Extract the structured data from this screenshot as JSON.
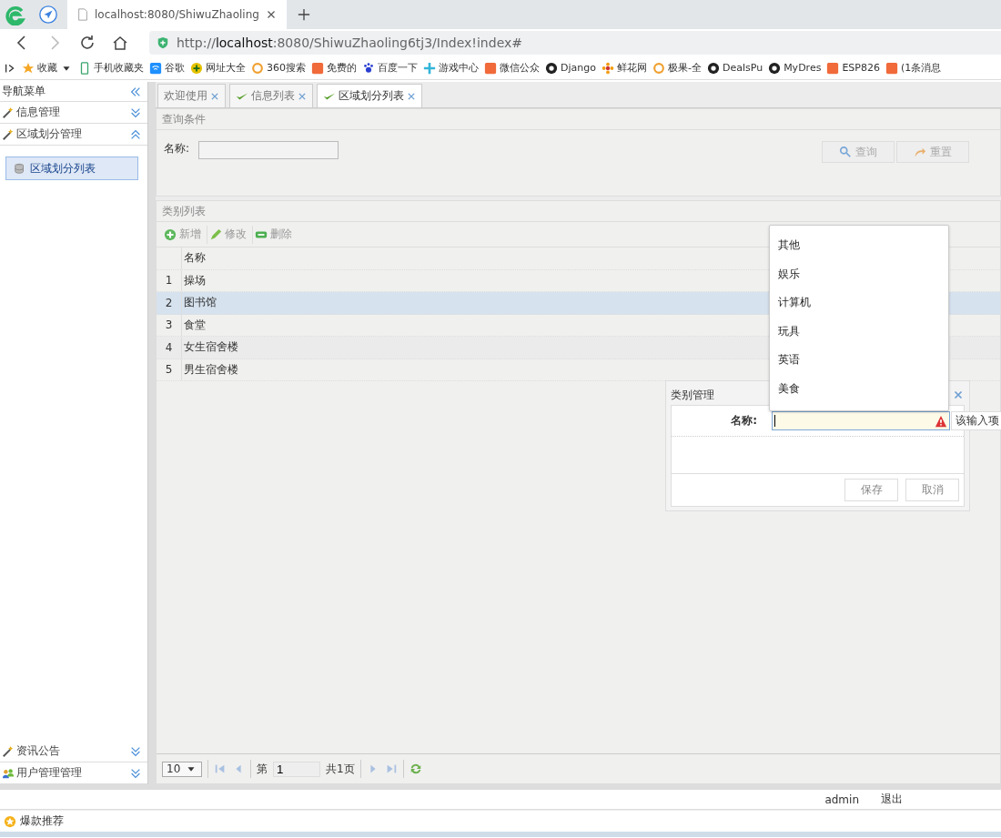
{
  "browser": {
    "tab_title": "localhost:8080/ShiwuZhaoling",
    "url_prefix": "http://",
    "url_host": "localhost",
    "url_rest": ":8080/ShiwuZhaoling6tj3/Index!index#",
    "bookmarks": [
      {
        "label": "收藏",
        "kind": "star"
      },
      {
        "label": "手机收藏夹",
        "kind": "phone"
      },
      {
        "label": "谷歌",
        "kind": "wifi"
      },
      {
        "label": "网址大全",
        "kind": "plus"
      },
      {
        "label": "360搜索",
        "kind": "ring"
      },
      {
        "label": "免费的",
        "kind": "square"
      },
      {
        "label": "百度一下",
        "kind": "paw"
      },
      {
        "label": "游戏中心",
        "kind": "cross"
      },
      {
        "label": "微信公众",
        "kind": "square"
      },
      {
        "label": "Django",
        "kind": "glyph"
      },
      {
        "label": "鲜花网",
        "kind": "flower"
      },
      {
        "label": "极果-全",
        "kind": "ring"
      },
      {
        "label": "DealsPu",
        "kind": "glyph"
      },
      {
        "label": "MyDres",
        "kind": "glyph"
      },
      {
        "label": "ESP826",
        "kind": "square"
      },
      {
        "label": "(1条消息",
        "kind": "square"
      }
    ]
  },
  "sidebar": {
    "title": "导航菜单",
    "sections": [
      {
        "label": "信息管理",
        "expanded": false
      },
      {
        "label": "区域划分管理",
        "expanded": true,
        "items": [
          {
            "label": "区域划分列表",
            "selected": true
          }
        ]
      }
    ],
    "bottom_sections": [
      {
        "label": "资讯公告",
        "expanded": false,
        "kind": "wand"
      },
      {
        "label": "用户管理管理",
        "expanded": false,
        "kind": "users"
      }
    ]
  },
  "tabs": [
    {
      "label": "欢迎使用",
      "kind": "plain",
      "selected": false
    },
    {
      "label": "信息列表",
      "kind": "check",
      "selected": false
    },
    {
      "label": "区域划分列表",
      "kind": "check",
      "selected": true
    }
  ],
  "query": {
    "title": "查询条件",
    "field_label": "名称:",
    "buttons": [
      {
        "label": "查询",
        "kind": "search"
      },
      {
        "label": "重置",
        "kind": "reset"
      }
    ]
  },
  "list": {
    "title": "类别列表",
    "toolbar": [
      {
        "label": "新增",
        "kind": "add"
      },
      {
        "label": "修改",
        "kind": "edit"
      },
      {
        "label": "删除",
        "kind": "delete"
      }
    ],
    "columns": [
      "名称"
    ],
    "rows": [
      {
        "num": "1",
        "name": "操场",
        "selected": false
      },
      {
        "num": "2",
        "name": "图书馆",
        "selected": true
      },
      {
        "num": "3",
        "name": "食堂",
        "selected": false
      },
      {
        "num": "4",
        "name": "女生宿舍楼",
        "selected": false
      },
      {
        "num": "5",
        "name": "男生宿舍楼",
        "selected": false
      }
    ],
    "pager": {
      "page_size": "10",
      "page_prefix": "第",
      "page": "1",
      "total": "共1页"
    }
  },
  "dialog": {
    "title": "类别管理",
    "field_label": "名称:",
    "invalid": true,
    "tooltip": "该输入项",
    "buttons": [
      "保存",
      "取消"
    ]
  },
  "autocomplete": [
    "其他",
    "娱乐",
    "计算机",
    "玩具",
    "英语",
    "美食"
  ],
  "footer": {
    "user": "admin",
    "logout": "退出"
  },
  "bottom_bar": {
    "label": "爆款推荐"
  }
}
